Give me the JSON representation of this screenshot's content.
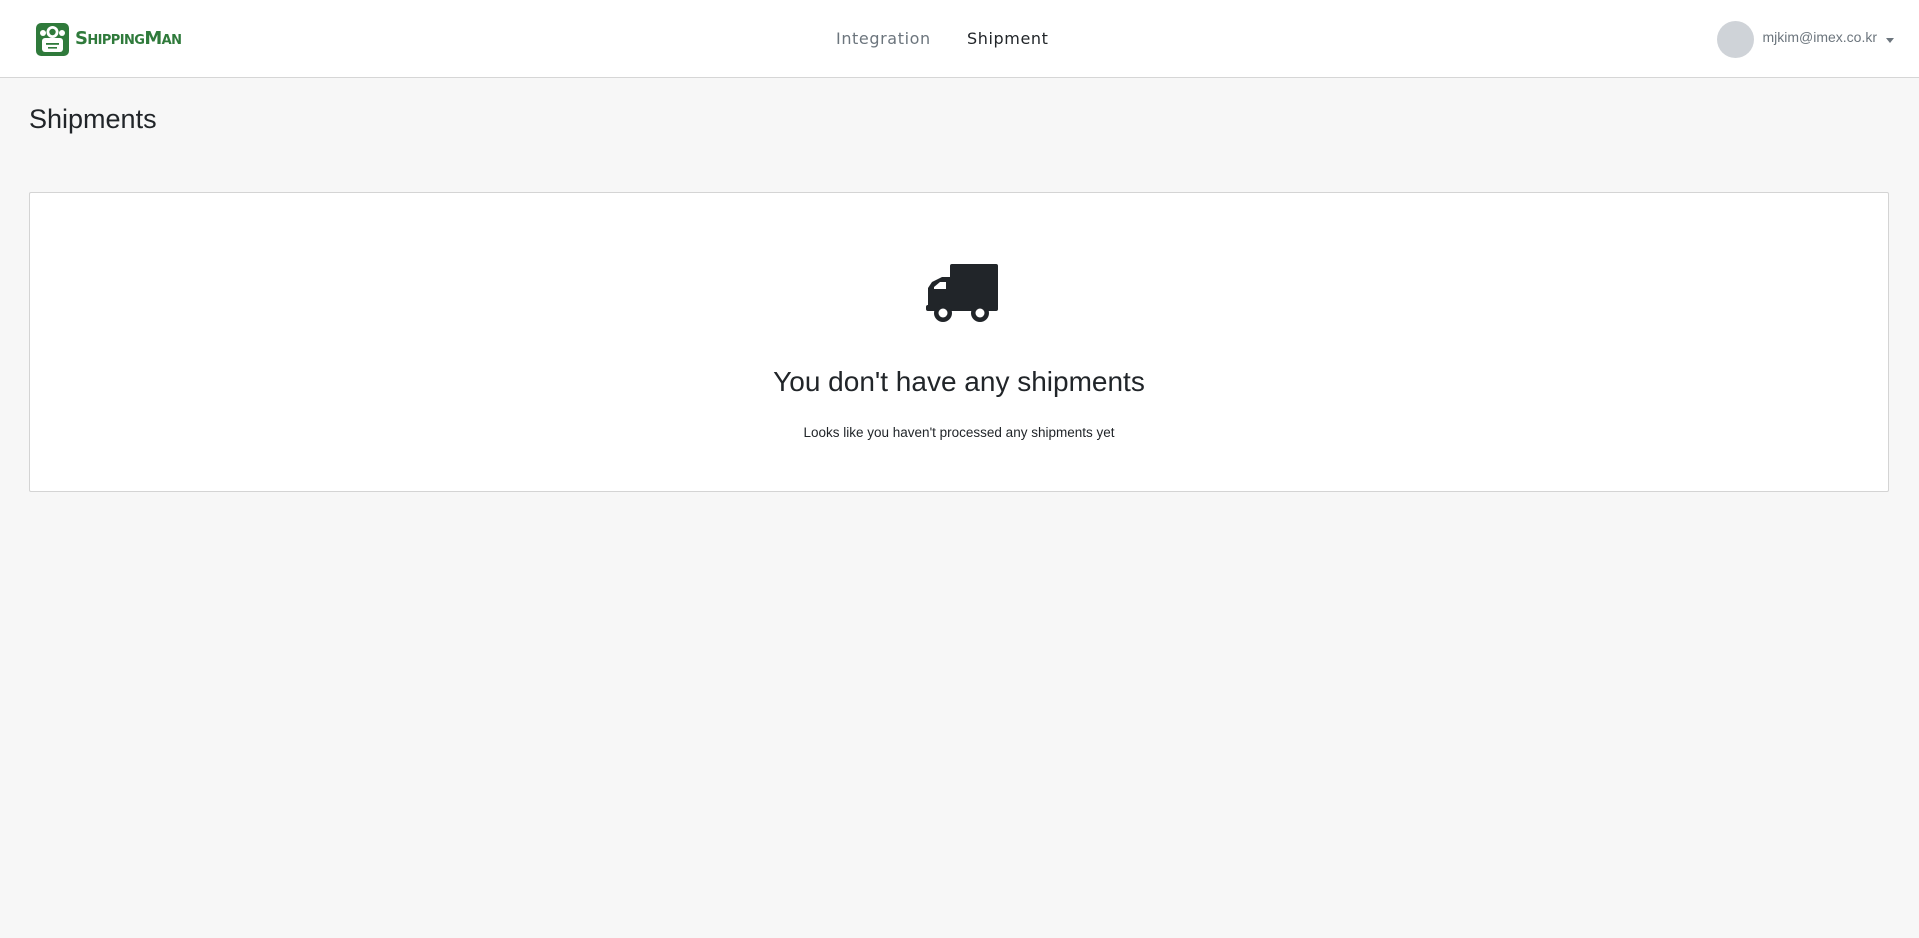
{
  "header": {
    "brand_name": "ShippingMan",
    "nav": [
      {
        "label": "Integration",
        "active": false
      },
      {
        "label": "Shipment",
        "active": true
      }
    ],
    "user": {
      "email": "mjkim@imex.co.kr"
    }
  },
  "page": {
    "title": "Shipments"
  },
  "empty_state": {
    "icon": "truck-icon",
    "title": "You don't have any shipments",
    "subtitle": "Looks like you haven't processed any shipments yet"
  },
  "colors": {
    "brand_green": "#2f7a3b",
    "page_background": "#f7f7f7",
    "text_dark": "#212529",
    "text_muted": "#6c757d",
    "avatar_gray": "#cfd3d8"
  }
}
